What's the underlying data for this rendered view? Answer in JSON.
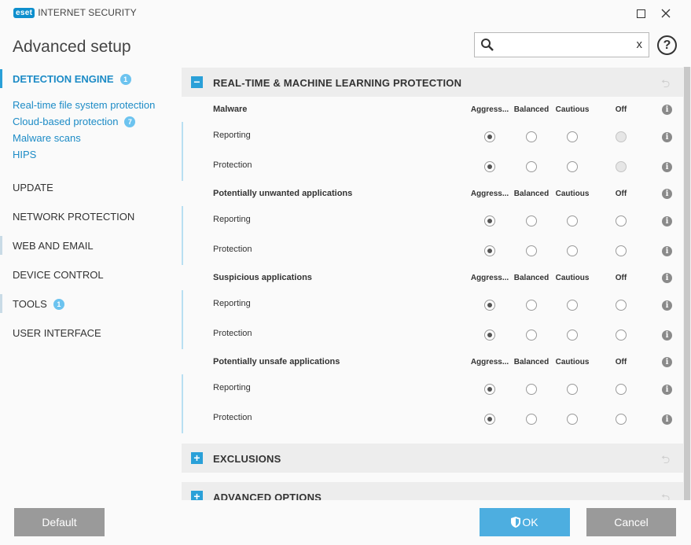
{
  "app": {
    "logo_badge": "eset",
    "logo_text": "INTERNET SECURITY",
    "page_title": "Advanced setup"
  },
  "search": {
    "value": "",
    "placeholder": "",
    "clear": "x"
  },
  "help": "?",
  "sidebar": {
    "detection": {
      "label": "DETECTION ENGINE",
      "badge": "1"
    },
    "subs": [
      "Real-time file system protection",
      "Cloud-based protection",
      "Malware scans",
      "HIPS"
    ],
    "cloud_badge": "7",
    "update": "UPDATE",
    "network": "NETWORK PROTECTION",
    "web": "WEB AND EMAIL",
    "device": "DEVICE CONTROL",
    "tools": {
      "label": "TOOLS",
      "badge": "1"
    },
    "ui": "USER INTERFACE"
  },
  "sections": {
    "realtime": "REAL-TIME & MACHINE LEARNING PROTECTION",
    "exclusions": "EXCLUSIONS",
    "advanced": "ADVANCED OPTIONS"
  },
  "columns": [
    "Aggress...",
    "Balanced",
    "Cautious",
    "Off"
  ],
  "row_labels": {
    "reporting": "Reporting",
    "protection": "Protection"
  },
  "groups": [
    {
      "title": "Malware",
      "reporting": "Aggressive",
      "protection": "Aggressive",
      "off_disabled": true
    },
    {
      "title": "Potentially unwanted applications",
      "reporting": "Aggressive",
      "protection": "Aggressive",
      "off_disabled": false
    },
    {
      "title": "Suspicious applications",
      "reporting": "Aggressive",
      "protection": "Aggressive",
      "off_disabled": false
    },
    {
      "title": "Potentially unsafe applications",
      "reporting": "Aggressive",
      "protection": "Aggressive",
      "off_disabled": false
    }
  ],
  "buttons": {
    "default": "Default",
    "ok": "OK",
    "cancel": "Cancel"
  },
  "colors": {
    "accent": "#2aa0d8",
    "button_gray": "#9a9a9a",
    "ok": "#4daee0"
  }
}
